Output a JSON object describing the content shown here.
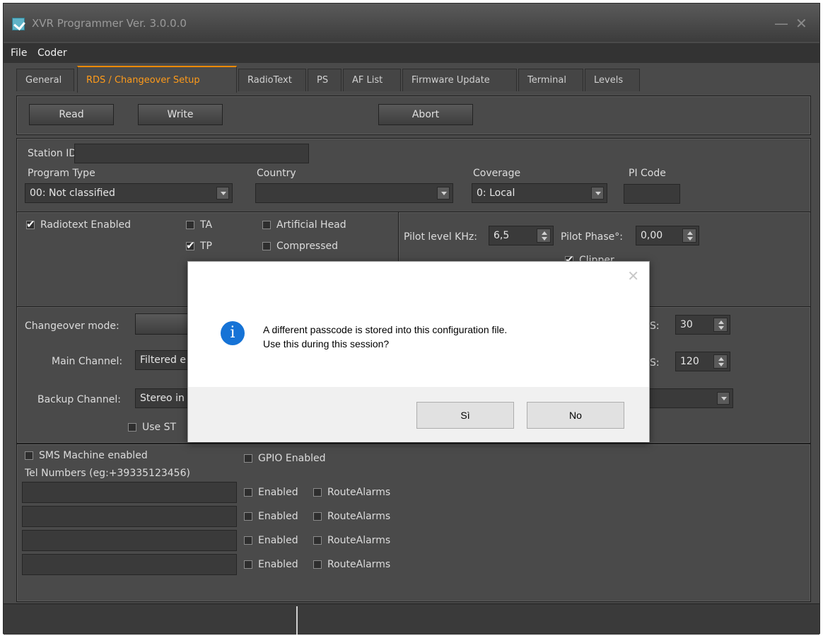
{
  "window": {
    "title": "XVR Programmer  Ver. 3.0.0.0",
    "minimize": "—",
    "close": "✕"
  },
  "menu": [
    "File",
    "Coder"
  ],
  "tabs": [
    "General",
    "RDS / Changeover Setup",
    "RadioText",
    "PS",
    "AF List",
    "Firmware Update",
    "Terminal",
    "Levels"
  ],
  "toolbar": {
    "read": "Read",
    "write": "Write",
    "abort": "Abort"
  },
  "station": {
    "station_id_label": "Station ID",
    "station_id_value": "",
    "program_type_label": "Program Type",
    "program_type_value": "00: Not classified",
    "country_label": "Country",
    "country_value": "",
    "coverage_label": "Coverage",
    "coverage_value": "0: Local",
    "pi_code_label": "PI Code",
    "pi_code_value": ""
  },
  "flags": {
    "radiotext_enabled": "Radiotext Enabled",
    "ta": "TA",
    "tp": "TP",
    "artificial_head": "Artificial Head",
    "compressed": "Compressed"
  },
  "pilot": {
    "level_label": "Pilot level KHz:",
    "level_value": "6,5",
    "phase_label": "Pilot Phase°:",
    "phase_value": "0,00",
    "clipper": "Clipper"
  },
  "changeover": {
    "mode_label": "Changeover mode:",
    "main_label": "Main Channel:",
    "main_value": "Filtered e",
    "backup_label": "Backup Channel:",
    "backup_value": "Stereo in",
    "use_st": "Use ST",
    "s1_label": "S:",
    "s1_value": "30",
    "s2_label": "S:",
    "s2_value": "120"
  },
  "sms": {
    "machine_enabled": "SMS Machine enabled",
    "tel_label": "Tel Numbers (eg:+39335123456)",
    "gpio_enabled": "GPIO Enabled",
    "enabled": "Enabled",
    "route_alarms": "RouteAlarms"
  },
  "dialog": {
    "close": "✕",
    "icon": "i",
    "line1": "A different passcode is stored into this configuration file.",
    "line2": "Use this during this session?",
    "yes": "Sì",
    "no": "No"
  }
}
